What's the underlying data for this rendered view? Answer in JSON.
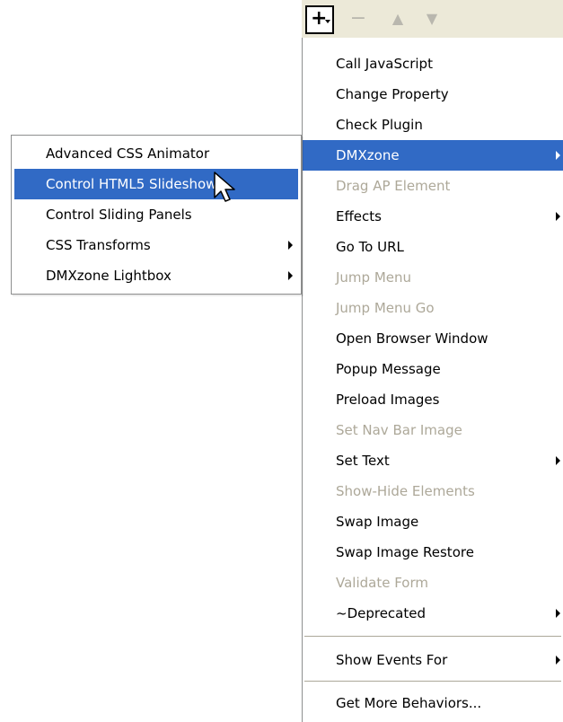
{
  "toolbar": {
    "add_label": "+",
    "remove_label": "−",
    "move_up_label": "▲",
    "move_down_label": "▼"
  },
  "main_menu": {
    "items": [
      {
        "label": "Call JavaScript",
        "state": "enabled",
        "submenu": false
      },
      {
        "label": "Change Property",
        "state": "enabled",
        "submenu": false
      },
      {
        "label": "Check Plugin",
        "state": "enabled",
        "submenu": false
      },
      {
        "label": "DMXzone",
        "state": "selected",
        "submenu": true
      },
      {
        "label": "Drag AP Element",
        "state": "disabled",
        "submenu": false
      },
      {
        "label": "Effects",
        "state": "enabled",
        "submenu": true
      },
      {
        "label": "Go To URL",
        "state": "enabled",
        "submenu": false
      },
      {
        "label": "Jump Menu",
        "state": "disabled",
        "submenu": false
      },
      {
        "label": "Jump Menu Go",
        "state": "disabled",
        "submenu": false
      },
      {
        "label": "Open Browser Window",
        "state": "enabled",
        "submenu": false
      },
      {
        "label": "Popup Message",
        "state": "enabled",
        "submenu": false
      },
      {
        "label": "Preload Images",
        "state": "enabled",
        "submenu": false
      },
      {
        "label": "Set Nav Bar Image",
        "state": "disabled",
        "submenu": false
      },
      {
        "label": "Set Text",
        "state": "enabled",
        "submenu": true
      },
      {
        "label": "Show-Hide Elements",
        "state": "disabled",
        "submenu": false
      },
      {
        "label": "Swap Image",
        "state": "enabled",
        "submenu": false
      },
      {
        "label": "Swap Image Restore",
        "state": "enabled",
        "submenu": false
      },
      {
        "label": "Validate Form",
        "state": "disabled",
        "submenu": false
      },
      {
        "label": "~Deprecated",
        "state": "enabled",
        "submenu": true
      }
    ],
    "show_events_for": "Show Events For",
    "get_more_behaviors": "Get More Behaviors..."
  },
  "dmxzone_submenu": {
    "items": [
      {
        "label": "Advanced CSS Animator",
        "state": "enabled",
        "submenu": false
      },
      {
        "label": "Control HTML5 Slideshow",
        "state": "selected",
        "submenu": false
      },
      {
        "label": "Control Sliding Panels",
        "state": "enabled",
        "submenu": false
      },
      {
        "label": "CSS Transforms",
        "state": "enabled",
        "submenu": true
      },
      {
        "label": "DMXzone Lightbox",
        "state": "enabled",
        "submenu": true
      }
    ]
  },
  "colors": {
    "selection": "#316ac5",
    "disabled_text": "#ada899",
    "toolbar_bg": "#ece9d8"
  },
  "icons": {
    "add": "plus-dropdown-icon",
    "remove": "minus-icon",
    "move_up": "triangle-up-icon",
    "move_down": "triangle-down-icon",
    "submenu": "submenu-arrow-icon",
    "cursor": "mouse-pointer-icon"
  }
}
